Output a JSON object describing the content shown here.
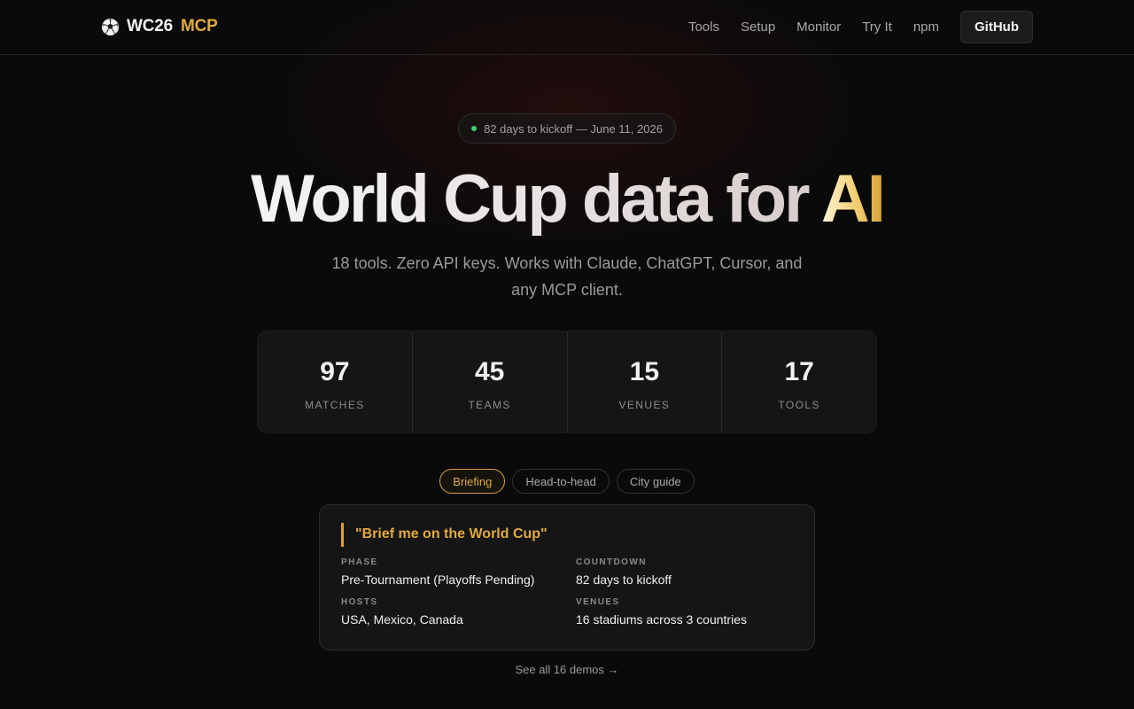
{
  "nav": {
    "brand_main": "WC26",
    "brand_accent": "MCP",
    "logo_icon": "soccer-ball-icon",
    "links": [
      "Tools",
      "Setup",
      "Monitor",
      "Try It",
      "npm"
    ],
    "github_label": "GitHub"
  },
  "hero": {
    "pill_text": "82 days to kickoff — June 11, 2026",
    "pill_dot_color": "#3fcf6a",
    "headline_main": "World Cup data for ",
    "headline_accent": "AI",
    "subtitle": "18 tools. Zero API keys. Works with Claude, ChatGPT, Cursor, and any MCP client."
  },
  "stats": [
    {
      "value": "97",
      "label": "MATCHES"
    },
    {
      "value": "45",
      "label": "TEAMS"
    },
    {
      "value": "15",
      "label": "VENUES"
    },
    {
      "value": "17",
      "label": "TOOLS"
    }
  ],
  "demo": {
    "tabs": [
      "Briefing",
      "Head-to-head",
      "City guide"
    ],
    "active_tab": "Briefing",
    "quote": "\"Brief me on the World Cup\"",
    "fields": [
      {
        "key": "PHASE",
        "value": "Pre-Tournament (Playoffs Pending)"
      },
      {
        "key": "COUNTDOWN",
        "value": "82 days to kickoff"
      },
      {
        "key": "HOSTS",
        "value": "USA, Mexico, Canada"
      },
      {
        "key": "VENUES",
        "value": "16 stadiums across 3 countries"
      }
    ],
    "see_all": "See all 16 demos →"
  },
  "colors": {
    "accent": "#e0aa3e",
    "background": "#0a0a0a",
    "panel": "#151515"
  }
}
